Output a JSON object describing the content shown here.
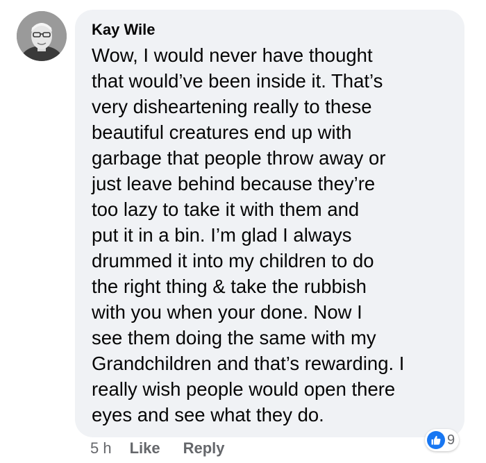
{
  "comment": {
    "author": "Kay Wile",
    "lines": [
      "Wow, I would never  have  thought",
      "that  would’ve been inside it.  That’s",
      "very  disheartening really  to these",
      "beautiful creatures  end  up  with",
      "garbage  that  people  throw  away  or",
      "just  leave  behind  because they’re",
      "too  lazy  to  take  it  with  them  and",
      "put  it  in  a  bin. I’m glad  I  always",
      "drummed  it  into  my  children  to  do",
      "the  right  thing  &  take  the  rubbish",
      "with  you  when  your  done.  Now  I",
      "see  them  doing  the  same  with  my",
      "Grandchildren and  that’s rewarding. I",
      "really wish  people  would  open  there",
      "eyes and  see  what  they  do."
    ]
  },
  "actions": {
    "time": "5 h",
    "like_label": "Like",
    "reply_label": "Reply"
  },
  "reactions": {
    "icon": "thumbs-up-icon",
    "count": "9",
    "color": "#1877f2"
  },
  "colors": {
    "bubble": "#f0f2f5",
    "text": "#050505",
    "meta": "#65676b"
  }
}
